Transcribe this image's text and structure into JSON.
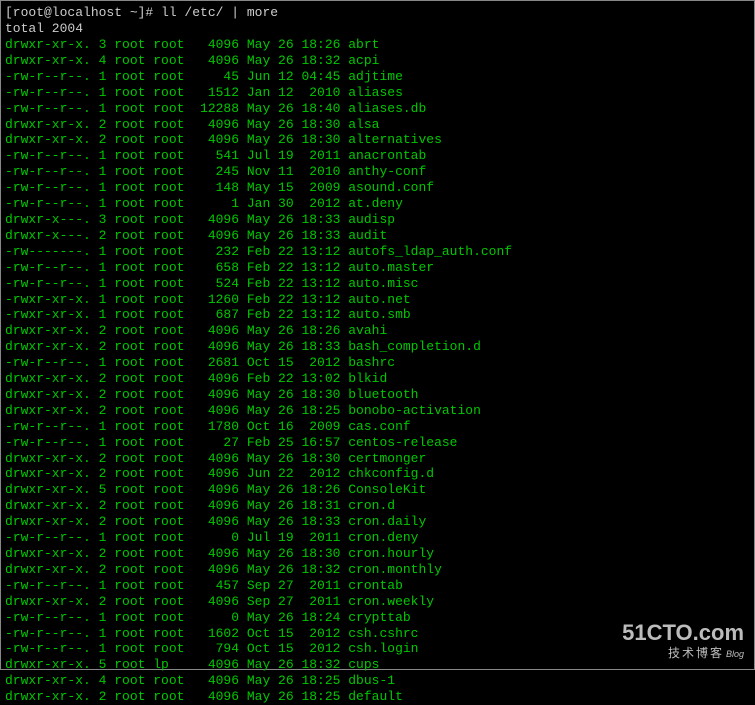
{
  "prompt": {
    "host": "[root@localhost ~]# ",
    "command": "ll /etc/ | more"
  },
  "total": "total 2004",
  "watermark": {
    "main": "51CTO.com",
    "sub": "技术博客",
    "blog": "Blog"
  },
  "rows": [
    {
      "perm": "drwxr-xr-x.",
      "links": "3",
      "owner": "root",
      "group": "root",
      "size": "4096",
      "month": "May",
      "day": "26",
      "time": "18:26",
      "name": "abrt"
    },
    {
      "perm": "drwxr-xr-x.",
      "links": "4",
      "owner": "root",
      "group": "root",
      "size": "4096",
      "month": "May",
      "day": "26",
      "time": "18:32",
      "name": "acpi"
    },
    {
      "perm": "-rw-r--r--.",
      "links": "1",
      "owner": "root",
      "group": "root",
      "size": "45",
      "month": "Jun",
      "day": "12",
      "time": "04:45",
      "name": "adjtime"
    },
    {
      "perm": "-rw-r--r--.",
      "links": "1",
      "owner": "root",
      "group": "root",
      "size": "1512",
      "month": "Jan",
      "day": "12",
      "time": " 2010",
      "name": "aliases"
    },
    {
      "perm": "-rw-r--r--.",
      "links": "1",
      "owner": "root",
      "group": "root",
      "size": "12288",
      "month": "May",
      "day": "26",
      "time": "18:40",
      "name": "aliases.db"
    },
    {
      "perm": "drwxr-xr-x.",
      "links": "2",
      "owner": "root",
      "group": "root",
      "size": "4096",
      "month": "May",
      "day": "26",
      "time": "18:30",
      "name": "alsa"
    },
    {
      "perm": "drwxr-xr-x.",
      "links": "2",
      "owner": "root",
      "group": "root",
      "size": "4096",
      "month": "May",
      "day": "26",
      "time": "18:30",
      "name": "alternatives"
    },
    {
      "perm": "-rw-r--r--.",
      "links": "1",
      "owner": "root",
      "group": "root",
      "size": "541",
      "month": "Jul",
      "day": "19",
      "time": " 2011",
      "name": "anacrontab"
    },
    {
      "perm": "-rw-r--r--.",
      "links": "1",
      "owner": "root",
      "group": "root",
      "size": "245",
      "month": "Nov",
      "day": "11",
      "time": " 2010",
      "name": "anthy-conf"
    },
    {
      "perm": "-rw-r--r--.",
      "links": "1",
      "owner": "root",
      "group": "root",
      "size": "148",
      "month": "May",
      "day": "15",
      "time": " 2009",
      "name": "asound.conf"
    },
    {
      "perm": "-rw-r--r--.",
      "links": "1",
      "owner": "root",
      "group": "root",
      "size": "1",
      "month": "Jan",
      "day": "30",
      "time": " 2012",
      "name": "at.deny"
    },
    {
      "perm": "drwxr-x---.",
      "links": "3",
      "owner": "root",
      "group": "root",
      "size": "4096",
      "month": "May",
      "day": "26",
      "time": "18:33",
      "name": "audisp"
    },
    {
      "perm": "drwxr-x---.",
      "links": "2",
      "owner": "root",
      "group": "root",
      "size": "4096",
      "month": "May",
      "day": "26",
      "time": "18:33",
      "name": "audit"
    },
    {
      "perm": "-rw-------.",
      "links": "1",
      "owner": "root",
      "group": "root",
      "size": "232",
      "month": "Feb",
      "day": "22",
      "time": "13:12",
      "name": "autofs_ldap_auth.conf"
    },
    {
      "perm": "-rw-r--r--.",
      "links": "1",
      "owner": "root",
      "group": "root",
      "size": "658",
      "month": "Feb",
      "day": "22",
      "time": "13:12",
      "name": "auto.master"
    },
    {
      "perm": "-rw-r--r--.",
      "links": "1",
      "owner": "root",
      "group": "root",
      "size": "524",
      "month": "Feb",
      "day": "22",
      "time": "13:12",
      "name": "auto.misc"
    },
    {
      "perm": "-rwxr-xr-x.",
      "links": "1",
      "owner": "root",
      "group": "root",
      "size": "1260",
      "month": "Feb",
      "day": "22",
      "time": "13:12",
      "name": "auto.net"
    },
    {
      "perm": "-rwxr-xr-x.",
      "links": "1",
      "owner": "root",
      "group": "root",
      "size": "687",
      "month": "Feb",
      "day": "22",
      "time": "13:12",
      "name": "auto.smb"
    },
    {
      "perm": "drwxr-xr-x.",
      "links": "2",
      "owner": "root",
      "group": "root",
      "size": "4096",
      "month": "May",
      "day": "26",
      "time": "18:26",
      "name": "avahi"
    },
    {
      "perm": "drwxr-xr-x.",
      "links": "2",
      "owner": "root",
      "group": "root",
      "size": "4096",
      "month": "May",
      "day": "26",
      "time": "18:33",
      "name": "bash_completion.d"
    },
    {
      "perm": "-rw-r--r--.",
      "links": "1",
      "owner": "root",
      "group": "root",
      "size": "2681",
      "month": "Oct",
      "day": "15",
      "time": " 2012",
      "name": "bashrc"
    },
    {
      "perm": "drwxr-xr-x.",
      "links": "2",
      "owner": "root",
      "group": "root",
      "size": "4096",
      "month": "Feb",
      "day": "22",
      "time": "13:02",
      "name": "blkid"
    },
    {
      "perm": "drwxr-xr-x.",
      "links": "2",
      "owner": "root",
      "group": "root",
      "size": "4096",
      "month": "May",
      "day": "26",
      "time": "18:30",
      "name": "bluetooth"
    },
    {
      "perm": "drwxr-xr-x.",
      "links": "2",
      "owner": "root",
      "group": "root",
      "size": "4096",
      "month": "May",
      "day": "26",
      "time": "18:25",
      "name": "bonobo-activation"
    },
    {
      "perm": "-rw-r--r--.",
      "links": "1",
      "owner": "root",
      "group": "root",
      "size": "1780",
      "month": "Oct",
      "day": "16",
      "time": " 2009",
      "name": "cas.conf"
    },
    {
      "perm": "-rw-r--r--.",
      "links": "1",
      "owner": "root",
      "group": "root",
      "size": "27",
      "month": "Feb",
      "day": "25",
      "time": "16:57",
      "name": "centos-release"
    },
    {
      "perm": "drwxr-xr-x.",
      "links": "2",
      "owner": "root",
      "group": "root",
      "size": "4096",
      "month": "May",
      "day": "26",
      "time": "18:30",
      "name": "certmonger"
    },
    {
      "perm": "drwxr-xr-x.",
      "links": "2",
      "owner": "root",
      "group": "root",
      "size": "4096",
      "month": "Jun",
      "day": "22",
      "time": " 2012",
      "name": "chkconfig.d"
    },
    {
      "perm": "drwxr-xr-x.",
      "links": "5",
      "owner": "root",
      "group": "root",
      "size": "4096",
      "month": "May",
      "day": "26",
      "time": "18:26",
      "name": "ConsoleKit"
    },
    {
      "perm": "drwxr-xr-x.",
      "links": "2",
      "owner": "root",
      "group": "root",
      "size": "4096",
      "month": "May",
      "day": "26",
      "time": "18:31",
      "name": "cron.d"
    },
    {
      "perm": "drwxr-xr-x.",
      "links": "2",
      "owner": "root",
      "group": "root",
      "size": "4096",
      "month": "May",
      "day": "26",
      "time": "18:33",
      "name": "cron.daily"
    },
    {
      "perm": "-rw-r--r--.",
      "links": "1",
      "owner": "root",
      "group": "root",
      "size": "0",
      "month": "Jul",
      "day": "19",
      "time": " 2011",
      "name": "cron.deny"
    },
    {
      "perm": "drwxr-xr-x.",
      "links": "2",
      "owner": "root",
      "group": "root",
      "size": "4096",
      "month": "May",
      "day": "26",
      "time": "18:30",
      "name": "cron.hourly"
    },
    {
      "perm": "drwxr-xr-x.",
      "links": "2",
      "owner": "root",
      "group": "root",
      "size": "4096",
      "month": "May",
      "day": "26",
      "time": "18:32",
      "name": "cron.monthly"
    },
    {
      "perm": "-rw-r--r--.",
      "links": "1",
      "owner": "root",
      "group": "root",
      "size": "457",
      "month": "Sep",
      "day": "27",
      "time": " 2011",
      "name": "crontab"
    },
    {
      "perm": "drwxr-xr-x.",
      "links": "2",
      "owner": "root",
      "group": "root",
      "size": "4096",
      "month": "Sep",
      "day": "27",
      "time": " 2011",
      "name": "cron.weekly"
    },
    {
      "perm": "-rw-r--r--.",
      "links": "1",
      "owner": "root",
      "group": "root",
      "size": "0",
      "month": "May",
      "day": "26",
      "time": "18:24",
      "name": "crypttab"
    },
    {
      "perm": "-rw-r--r--.",
      "links": "1",
      "owner": "root",
      "group": "root",
      "size": "1602",
      "month": "Oct",
      "day": "15",
      "time": " 2012",
      "name": "csh.cshrc"
    },
    {
      "perm": "-rw-r--r--.",
      "links": "1",
      "owner": "root",
      "group": "root",
      "size": "794",
      "month": "Oct",
      "day": "15",
      "time": " 2012",
      "name": "csh.login"
    },
    {
      "perm": "drwxr-xr-x.",
      "links": "5",
      "owner": "root",
      "group": "lp  ",
      "size": "4096",
      "month": "May",
      "day": "26",
      "time": "18:32",
      "name": "cups"
    },
    {
      "perm": "drwxr-xr-x.",
      "links": "4",
      "owner": "root",
      "group": "root",
      "size": "4096",
      "month": "May",
      "day": "26",
      "time": "18:25",
      "name": "dbus-1"
    },
    {
      "perm": "drwxr-xr-x.",
      "links": "2",
      "owner": "root",
      "group": "root",
      "size": "4096",
      "month": "May",
      "day": "26",
      "time": "18:25",
      "name": "default"
    }
  ]
}
